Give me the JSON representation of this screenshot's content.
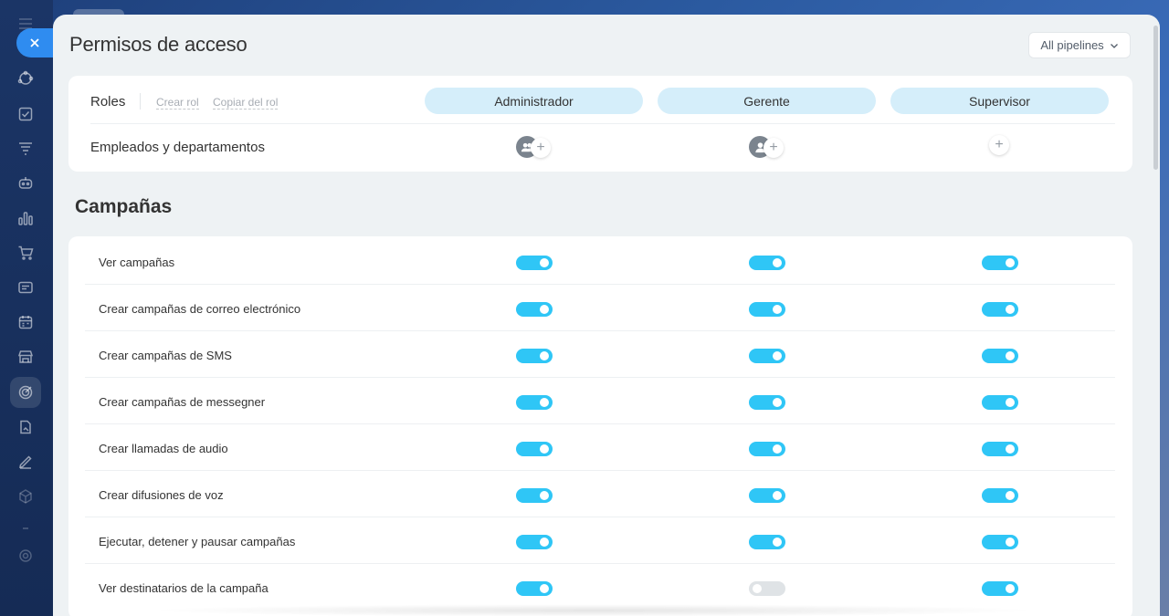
{
  "page_title": "Permisos de acceso",
  "pipelines_dropdown": {
    "selected": "All pipelines",
    "icon": "chevron-down-icon"
  },
  "roles": {
    "label": "Roles",
    "create_link": "Crear rol",
    "copy_link": "Copiar del rol",
    "columns": [
      "Administrador",
      "Gerente",
      "Supervisor"
    ]
  },
  "employees": {
    "label": "Empleados y departamentos",
    "add_symbol": "+"
  },
  "section_title": "Campañas",
  "permissions": [
    {
      "label": "Ver campañas",
      "values": [
        true,
        true,
        true
      ]
    },
    {
      "label": "Crear campañas de correo electrónico",
      "values": [
        true,
        true,
        true
      ]
    },
    {
      "label": "Crear campañas de SMS",
      "values": [
        true,
        true,
        true
      ]
    },
    {
      "label": "Crear campañas de messegner",
      "values": [
        true,
        true,
        true
      ]
    },
    {
      "label": "Crear llamadas de audio",
      "values": [
        true,
        true,
        true
      ]
    },
    {
      "label": "Crear difusiones de voz",
      "values": [
        true,
        true,
        true
      ]
    },
    {
      "label": "Ejecutar, detener y pausar campañas",
      "values": [
        true,
        true,
        true
      ]
    },
    {
      "label": "Ver destinatarios de la campaña",
      "values": [
        true,
        false,
        true
      ]
    }
  ],
  "colors": {
    "toggle_on": "#2fc6f6",
    "toggle_off": "#dfe3e6",
    "role_pill": "#d5eefa",
    "close_button": "#2f8cf0"
  }
}
